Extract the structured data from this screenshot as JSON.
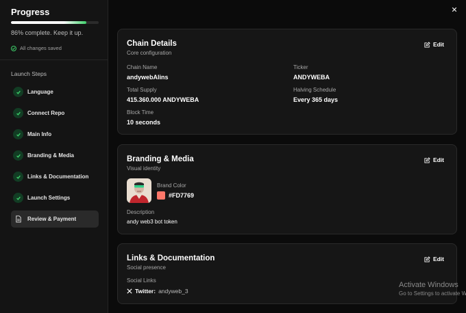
{
  "sidebar": {
    "title": "Progress",
    "progress_percent": 86,
    "progress_text": "86% complete. Keep it up.",
    "saved_text": "All changes saved",
    "steps_heading": "Launch Steps",
    "steps": [
      {
        "label": "Language",
        "status": "done"
      },
      {
        "label": "Connect Repo",
        "status": "done"
      },
      {
        "label": "Main Info",
        "status": "done"
      },
      {
        "label": "Branding & Media",
        "status": "done"
      },
      {
        "label": "Links & Documentation",
        "status": "done"
      },
      {
        "label": "Launch Settings",
        "status": "done"
      },
      {
        "label": "Review & Payment",
        "status": "active"
      }
    ]
  },
  "chain": {
    "title": "Chain Details",
    "subtitle": "Core configuration",
    "edit_label": "Edit",
    "chain_name_label": "Chain Name",
    "chain_name": "andywebAlins",
    "ticker_label": "Ticker",
    "ticker": "ANDYWEBA",
    "supply_label": "Total Supply",
    "supply": "415.360.000 ANDYWEBA",
    "halving_label": "Halving Schedule",
    "halving": "Every 365 days",
    "block_time_label": "Block Time",
    "block_time": "10 seconds"
  },
  "branding": {
    "title": "Branding & Media",
    "subtitle": "Visual identity",
    "edit_label": "Edit",
    "brand_color_label": "Brand Color",
    "brand_color": "#FD7769",
    "description_label": "Description",
    "description": "andy web3 bot token"
  },
  "links": {
    "title": "Links & Documentation",
    "subtitle": "Social presence",
    "edit_label": "Edit",
    "social_label": "Social Links",
    "twitter_label": "Twitter:",
    "twitter_handle": "andyweb_3"
  },
  "watermark": {
    "line1": "Activate Windows",
    "line2": "Go to Settings to activate Wi"
  },
  "colors": {
    "accent_green": "#3ecf6a",
    "brand": "#FD7769",
    "background": "#0b0b0b"
  }
}
